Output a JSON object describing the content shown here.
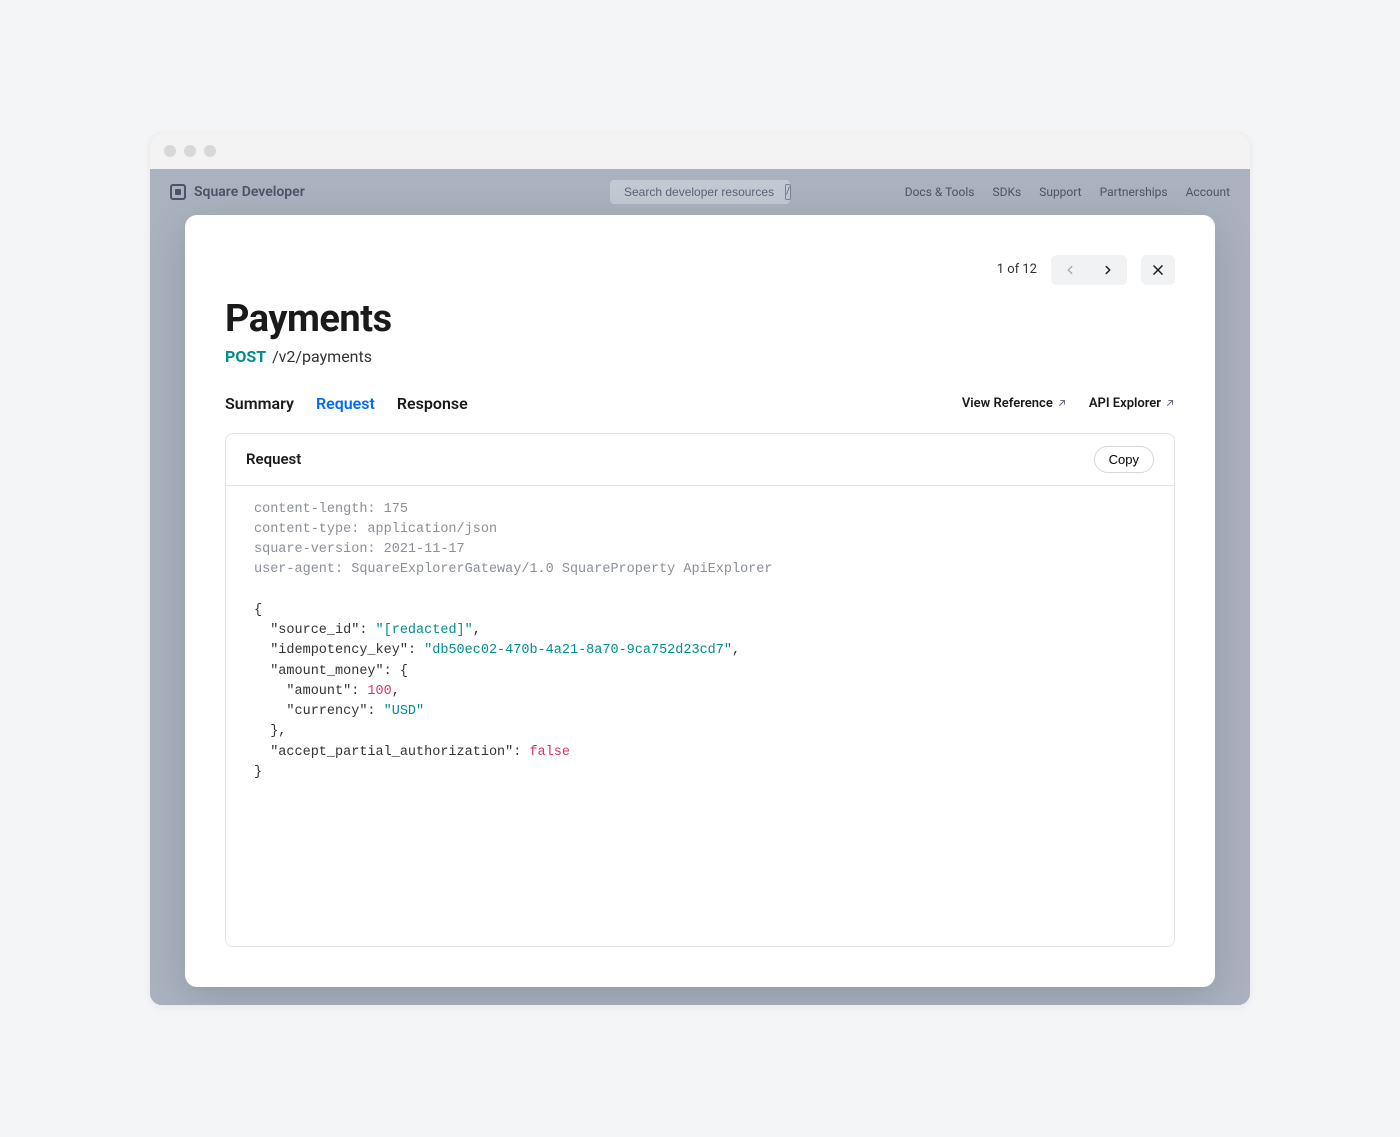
{
  "brand": "Square Developer",
  "search": {
    "placeholder": "Search developer resources",
    "shortcut": "/"
  },
  "nav": {
    "items": [
      "Docs & Tools",
      "SDKs",
      "Support",
      "Partnerships",
      "Account"
    ]
  },
  "modal": {
    "pager": {
      "label": "1 of 12"
    },
    "title": "Payments",
    "method": "POST",
    "path": "/v2/payments",
    "tabs": [
      "Summary",
      "Request",
      "Response"
    ],
    "active_tab": "Request",
    "links": {
      "view_reference": "View Reference",
      "api_explorer": "API Explorer"
    },
    "card": {
      "title": "Request",
      "copy_label": "Copy",
      "headers": [
        "content-length: 175",
        "content-type: application/json",
        "square-version: 2021-11-17",
        "user-agent: SquareExplorerGateway/1.0 SquareProperty ApiExplorer"
      ],
      "body": {
        "source_id_key": "\"source_id\"",
        "source_id_val": "\"[redacted]\"",
        "idem_key": "\"idempotency_key\"",
        "idem_val": "\"db50ec02-470b-4a21-8a70-9ca752d23cd7\"",
        "amount_money_key": "\"amount_money\"",
        "amount_key": "\"amount\"",
        "amount_val": "100",
        "currency_key": "\"currency\"",
        "currency_val": "\"USD\"",
        "accept_key": "\"accept_partial_authorization\"",
        "accept_val": "false"
      }
    }
  }
}
